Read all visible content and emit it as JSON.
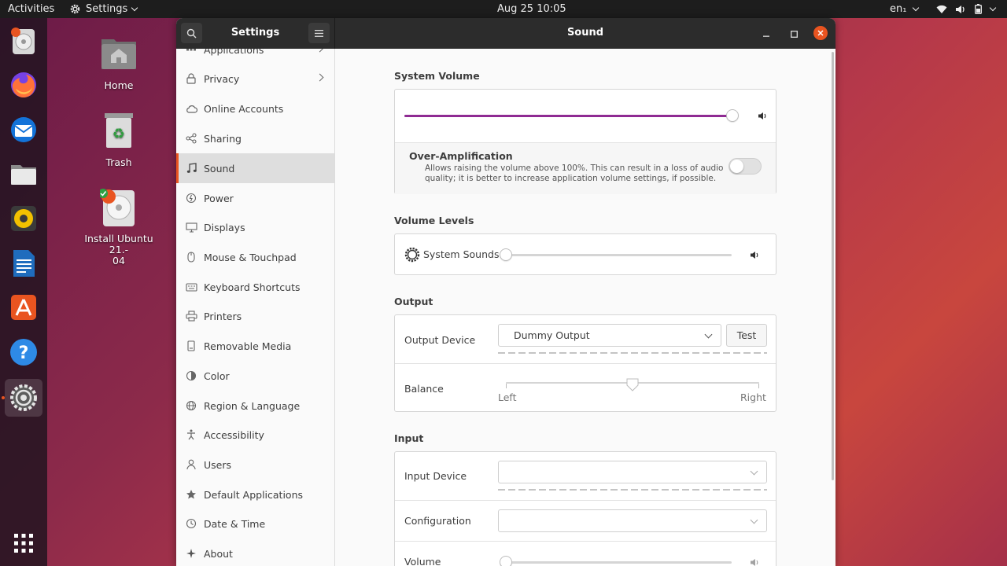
{
  "topbar": {
    "activities": "Activities",
    "app_menu": "Settings",
    "clock": "Aug 25  10:05",
    "keyboard_layout": "en₁"
  },
  "desktop": {
    "home_label": "Home",
    "trash_label": "Trash",
    "installer_label": "Install Ubuntu 21.-\n04"
  },
  "window": {
    "sidebar_title": "Settings",
    "panel_title": "Sound"
  },
  "sidebar": {
    "items": [
      {
        "label": "Applications",
        "icon": "apps-icon"
      },
      {
        "label": "Privacy",
        "icon": "lock-icon"
      },
      {
        "label": "Online Accounts",
        "icon": "cloud-icon"
      },
      {
        "label": "Sharing",
        "icon": "share-icon"
      },
      {
        "label": "Sound",
        "icon": "music-note-icon"
      },
      {
        "label": "Power",
        "icon": "power-icon"
      },
      {
        "label": "Displays",
        "icon": "display-icon"
      },
      {
        "label": "Mouse & Touchpad",
        "icon": "mouse-icon"
      },
      {
        "label": "Keyboard Shortcuts",
        "icon": "keyboard-icon"
      },
      {
        "label": "Printers",
        "icon": "printer-icon"
      },
      {
        "label": "Removable Media",
        "icon": "removable-media-icon"
      },
      {
        "label": "Color",
        "icon": "color-icon"
      },
      {
        "label": "Region & Language",
        "icon": "globe-icon"
      },
      {
        "label": "Accessibility",
        "icon": "accessibility-icon"
      },
      {
        "label": "Users",
        "icon": "user-icon"
      },
      {
        "label": "Default Applications",
        "icon": "star-icon"
      },
      {
        "label": "Date & Time",
        "icon": "clock-icon"
      },
      {
        "label": "About",
        "icon": "info-icon"
      }
    ]
  },
  "sound": {
    "system_volume": {
      "title": "System Volume",
      "level": 0.98,
      "over_amp_title": "Over-Amplification",
      "over_amp_desc_1": "Allows raising the volume above 100%. This can result in a loss of audio",
      "over_amp_desc_2": "quality; it is better to increase application volume settings, if possible.",
      "over_amp_enabled": false
    },
    "volume_levels": {
      "title": "Volume Levels",
      "system_sounds_label": "System Sounds",
      "system_sounds_level": 0.0
    },
    "output": {
      "title": "Output",
      "device_label": "Output Device",
      "device_value": "Dummy Output",
      "test_label": "Test",
      "balance_label": "Balance",
      "balance_left": "Left",
      "balance_right": "Right",
      "balance_value": 0.5
    },
    "input": {
      "title": "Input",
      "device_label": "Input Device",
      "device_value": "",
      "configuration_label": "Configuration",
      "configuration_value": "",
      "volume_label": "Volume"
    }
  },
  "colors": {
    "accent": "#e95420",
    "slider_fill": "#8f2b93"
  }
}
